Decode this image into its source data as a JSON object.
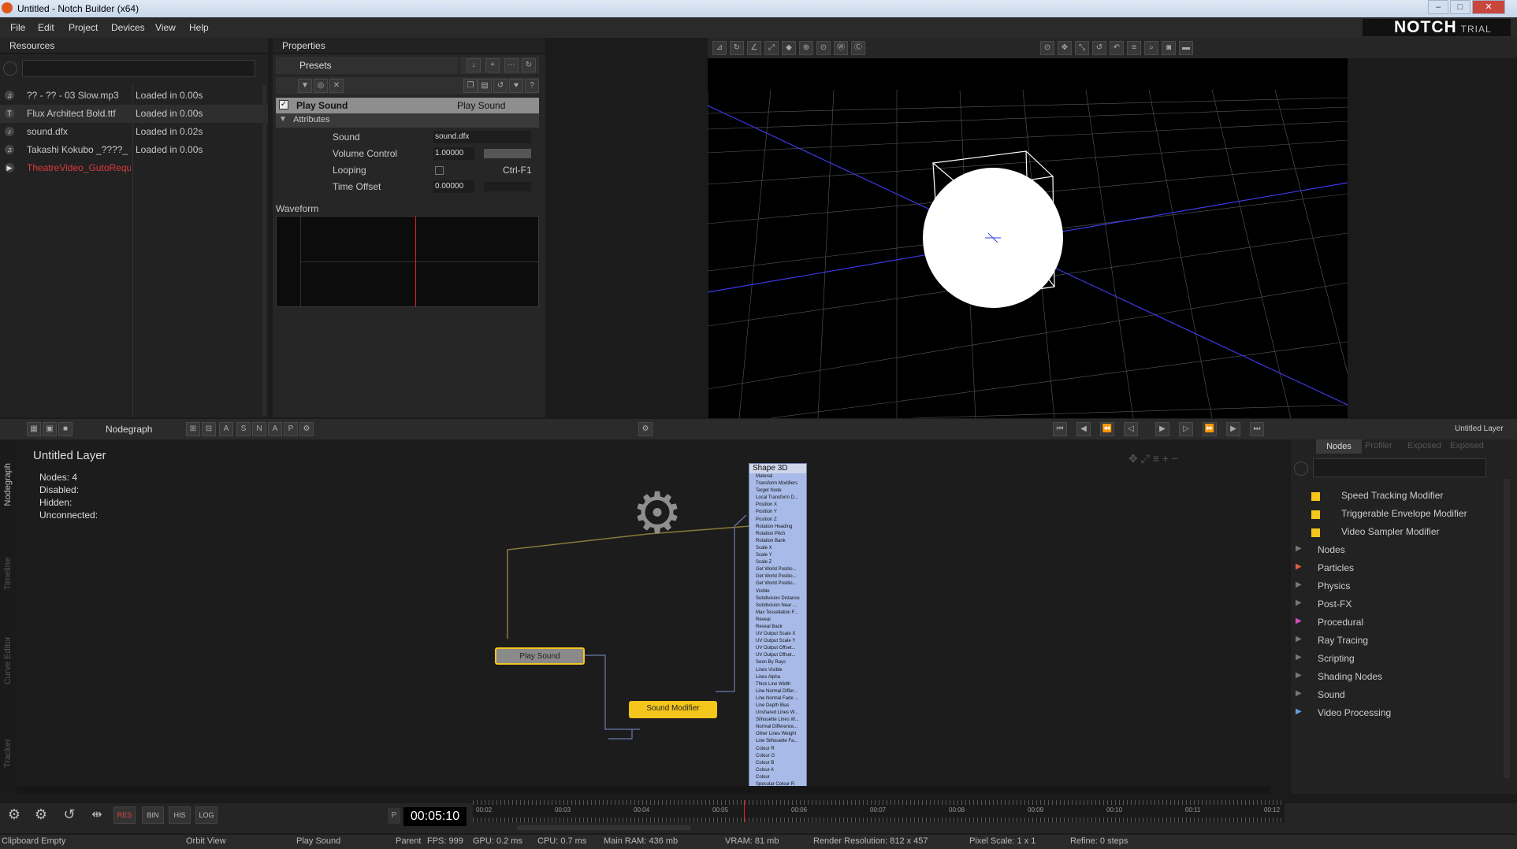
{
  "app": {
    "title": "Untitled - Notch Builder (x64)",
    "logo": "NOTCH",
    "logo_sub": "TRIAL"
  },
  "menu": [
    "File",
    "Edit",
    "Project",
    "Devices",
    "View",
    "Help"
  ],
  "resources": {
    "header": "Resources",
    "items": [
      {
        "icon": "music-note-icon",
        "name": "?? - ?? - 03 Slow.mp3",
        "status": "Loaded in 0.00s"
      },
      {
        "icon": "font-icon",
        "name": "Flux Architect Bold.ttf",
        "status": "Loaded in 0.00s"
      },
      {
        "icon": "file-icon",
        "name": "sound.dfx",
        "status": "Loaded in 0.02s"
      },
      {
        "icon": "music-note-icon",
        "name": "Takashi Kokubo _????_ - E",
        "status": "Loaded in 0.00s"
      },
      {
        "icon": "video-icon",
        "name": "TheatreVideo_GutoReque",
        "status": ""
      }
    ]
  },
  "properties": {
    "header": "Properties",
    "presets": "Presets",
    "node_name": "Play Sound",
    "node_type": "Play Sound",
    "attributes_label": "Attributes",
    "attrs": [
      {
        "label": "Sound",
        "value": "sound.dfx",
        "extra": ""
      },
      {
        "label": "Volume Control",
        "value": "1.00000",
        "extra": ""
      },
      {
        "label": "Looping",
        "value": "",
        "extra": "Ctrl-F1"
      },
      {
        "label": "Time Offset",
        "value": "0.00000",
        "extra": ""
      }
    ],
    "waveform_label": "Waveform"
  },
  "nodegraph": {
    "toolbar_label": "Nodegraph",
    "layer_title": "Untitled  Layer",
    "stats": [
      "Nodes:  4",
      "Disabled:",
      "Hidden:",
      "Unconnected:"
    ],
    "nodes": {
      "play_sound": "Play  Sound",
      "sound_modifier": "Sound  Modifier",
      "shape3d": "Shape  3D"
    },
    "shape_params": [
      "Material",
      "Transform Modifiers",
      "Target Node",
      "Local Transform D...",
      "Position X",
      "Position Y",
      "Position Z",
      "Rotation Heading",
      "Rotation Pitch",
      "Rotation Bank",
      "Scale X",
      "Scale Y",
      "Scale Z",
      "Get World Positio...",
      "Get World Positio...",
      "Get World Positio...",
      "Visible",
      "Subdivision Distance",
      "Subdivision Near ...",
      "Max Tessellation F...",
      "Reveal",
      "Reveal Back",
      "UV Output Scale X",
      "UV Output Scale Y",
      "UV Output Offset...",
      "UV Output Offset...",
      "Seen By Rays",
      "Lines Visible",
      "Lines Alpha",
      "Thick Line Width",
      "Line Normal Differ...",
      "Line Normal Fade ...",
      "Line Depth Bias",
      "Unshared Lines W...",
      "Silhouette Lines W...",
      "Normal Difference...",
      "Other Lines Weight",
      "Line Silhouette Fa...",
      "Colour R",
      "Colour G",
      "Colour B",
      "Colour A",
      "Colour",
      "Specular Colour R"
    ],
    "side_tabs": [
      "Nodegraph",
      "Timeline",
      "Curve Editor",
      "Tracker"
    ]
  },
  "nodes_panel": {
    "tabs": [
      "Nodes",
      "Profiler",
      "Exposed",
      "Exposed"
    ],
    "items": [
      {
        "label": "Speed Tracking Modifier",
        "kind": "swatch"
      },
      {
        "label": "Triggerable Envelope Modifier",
        "kind": "swatch"
      },
      {
        "label": "Video Sampler Modifier",
        "kind": "swatch"
      },
      {
        "label": "Nodes",
        "kind": "folder",
        "color": "#777777"
      },
      {
        "label": "Particles",
        "kind": "folder",
        "color": "#e06040"
      },
      {
        "label": "Physics",
        "kind": "folder",
        "color": "#777777"
      },
      {
        "label": "Post-FX",
        "kind": "folder",
        "color": "#777777"
      },
      {
        "label": "Procedural",
        "kind": "folder",
        "color": "#d050c0"
      },
      {
        "label": "Ray Tracing",
        "kind": "folder",
        "color": "#777777"
      },
      {
        "label": "Scripting",
        "kind": "folder",
        "color": "#777777"
      },
      {
        "label": "Shading Nodes",
        "kind": "folder",
        "color": "#777777"
      },
      {
        "label": "Sound",
        "kind": "folder",
        "color": "#777777"
      },
      {
        "label": "Video Processing",
        "kind": "folder",
        "color": "#5aa0e0"
      }
    ],
    "layer_label": "Untitled Layer"
  },
  "timeline": {
    "time": "00:05:10",
    "buttons": [
      "RES",
      "BIN",
      "HIS",
      "LOG"
    ],
    "ticks": [
      "00:02",
      "00:03",
      "00:04",
      "00:05",
      "00:06",
      "00:07",
      "00:08",
      "00:09",
      "00:10",
      "00:11",
      "00:12"
    ]
  },
  "status": [
    "Clipboard Empty",
    "Orbit View",
    "Play Sound",
    "Parent",
    "FPS: 999",
    "GPU: 0.2 ms",
    "CPU: 0.7 ms",
    "Main RAM: 436 mb",
    "VRAM: 81 mb",
    "Render Resolution: 812 x 457",
    "Pixel Scale: 1 x 1",
    "Refine: 0 steps"
  ],
  "colors": {
    "accent": "#f4c51b",
    "node_gray": "#8a8a8a",
    "shape_blue": "#a8bbe8",
    "playhead": "#e02020"
  }
}
